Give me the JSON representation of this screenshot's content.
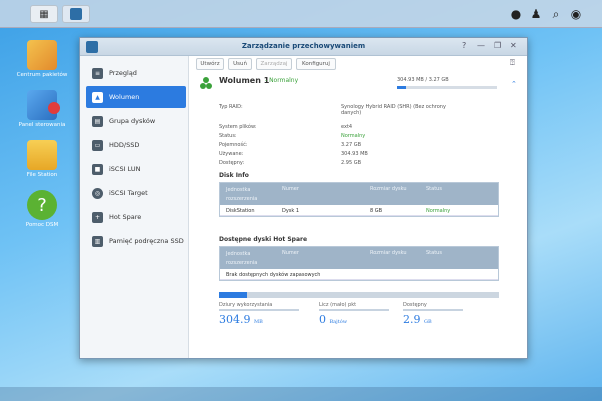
{
  "taskbar": {
    "menu_icon": "grid-icon",
    "app_icon": "storage-manager-icon",
    "tray": [
      "chat-icon",
      "user-icon",
      "search-icon",
      "options-icon"
    ]
  },
  "desktop_icons": [
    {
      "label": "Centrum pakietów",
      "icon": "package-center-icon",
      "color": "#e9a33a"
    },
    {
      "label": "Panel sterowania",
      "icon": "control-panel-icon",
      "color": "#3a8ad6"
    },
    {
      "label": "File Station",
      "icon": "folder-icon",
      "color": "#f1b934"
    },
    {
      "label": "Pomoc DSM",
      "icon": "help-icon",
      "color": "#5bb233"
    }
  ],
  "window": {
    "title": "Zarządzanie przechowywaniem",
    "controls": [
      "?",
      "—",
      "❐",
      "✕"
    ]
  },
  "sidebar": {
    "items": [
      {
        "label": "Przegląd",
        "icon": "overview-icon",
        "active": false
      },
      {
        "label": "Wolumen",
        "icon": "volume-icon",
        "active": true
      },
      {
        "label": "Grupa dysków",
        "icon": "disk-group-icon",
        "active": false
      },
      {
        "label": "HDD/SSD",
        "icon": "hdd-icon",
        "active": false
      },
      {
        "label": "iSCSI LUN",
        "icon": "lun-icon",
        "active": false
      },
      {
        "label": "iSCSI Target",
        "icon": "target-icon",
        "active": false
      },
      {
        "label": "Hot Spare",
        "icon": "hot-spare-icon",
        "active": false
      },
      {
        "label": "Pamięć podręczna SSD",
        "icon": "ssd-cache-icon",
        "active": false
      }
    ]
  },
  "toolbar": {
    "buttons": [
      "Utwórz",
      "Usuń",
      "Zarządzaj",
      "Konfiguruj"
    ],
    "help_icon": "help-icon"
  },
  "volume": {
    "title": "Wolumen 1",
    "status": "- Normalny",
    "usage": "304.93 MB / 3.27 GB",
    "usage_fraction": 0.09,
    "props": [
      {
        "k": "Typ RAID:",
        "v": "Synology Hybrid RAID (SHR) (Bez ochrony danych)"
      },
      {
        "k": "System plików:",
        "v": "ext4"
      },
      {
        "k": "Status:",
        "v": "Normalny"
      },
      {
        "k": "Pojemność:",
        "v": "3.27 GB"
      },
      {
        "k": "Używane:",
        "v": "304.93 MB"
      },
      {
        "k": "Dostępny:",
        "v": "2.95 GB"
      }
    ],
    "disk_info": {
      "title": "Disk Info",
      "headers": [
        "Jednostka rozszerzenia",
        "Numer",
        "Rozmiar dysku",
        "Status"
      ],
      "rows": [
        [
          "DiskStation",
          "Dysk 1",
          "8 GB",
          "Normalny"
        ]
      ]
    },
    "hot_spare": {
      "title": "Dostępne dyski Hot Spare",
      "headers": [
        "Jednostka rozszerzenia",
        "Numer",
        "Rozmiar dysku",
        "Status"
      ],
      "empty_text": "Brak dostępnych dysków zapasowych"
    },
    "stats": [
      {
        "label": "Dziury wykorzystania",
        "value": "304.9",
        "unit": "MB"
      },
      {
        "label": "Licz (mało) pkt",
        "value": "0",
        "unit": "Bajtów"
      },
      {
        "label": "Dostępny",
        "value": "2.9",
        "unit": "GB"
      }
    ]
  },
  "colors": {
    "accent": "#2c7be0",
    "ok": "#3aa13a",
    "warn": "#e03c3c"
  }
}
